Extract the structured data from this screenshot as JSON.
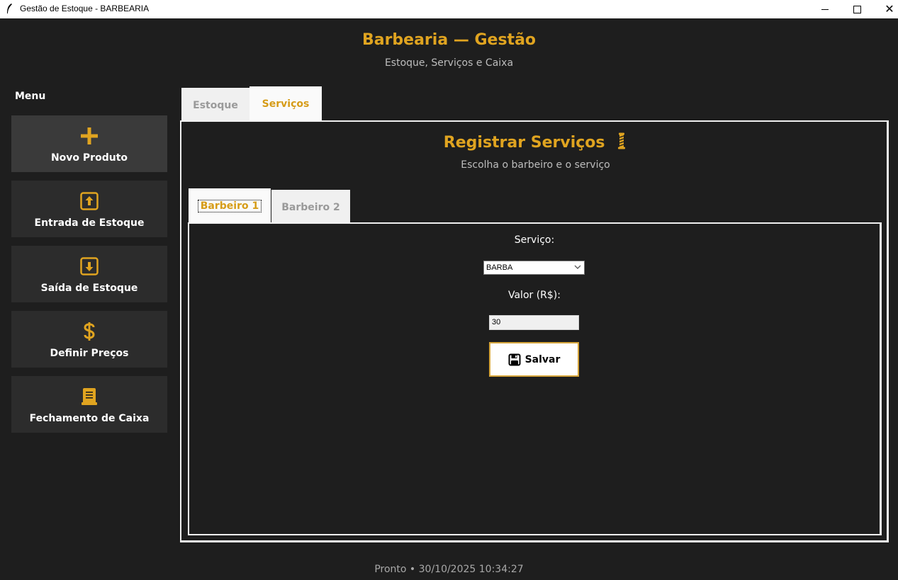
{
  "window": {
    "title": "Gestão de Estoque - BARBEARIA",
    "app_icon": "feather-icon",
    "controls": [
      "minimize-icon",
      "maximize-icon",
      "close-icon"
    ],
    "close_glyph": "✕"
  },
  "header": {
    "title": "Barbearia — Gestão",
    "subtitle": "Estoque, Serviços e Caixa"
  },
  "sidebar": {
    "label": "Menu",
    "items": [
      {
        "label": "Novo Produto",
        "icon": "plus-icon",
        "active": true
      },
      {
        "label": "Entrada de Estoque",
        "icon": "upload-arrow-icon",
        "active": false
      },
      {
        "label": "Saída de Estoque",
        "icon": "download-arrow-icon",
        "active": false
      },
      {
        "label": "Definir Preços",
        "icon": "dollar-icon",
        "active": false
      },
      {
        "label": "Fechamento de Caixa",
        "icon": "receipt-icon",
        "active": false
      }
    ]
  },
  "tabs": [
    {
      "label": "Estoque",
      "selected": false
    },
    {
      "label": "Serviços",
      "selected": true
    }
  ],
  "services": {
    "title": "Registrar Serviços",
    "title_icon": "barber-pole-icon",
    "subtitle": "Escolha o barbeiro e o serviço",
    "barber_tabs": [
      {
        "label": "Barbeiro 1",
        "selected": true
      },
      {
        "label": "Barbeiro 2",
        "selected": false
      }
    ],
    "service_label": "Serviço:",
    "service_value": "BARBA",
    "price_label": "Valor (R$):",
    "price_value": "30",
    "save_label": "Salvar",
    "save_icon": "floppy-disk-icon"
  },
  "status": "Pronto • 30/10/2025 10:34:27",
  "colors": {
    "accent": "#e0a420",
    "background": "#1e1e1e",
    "menu_button": "#2c2c2c",
    "menu_button_active": "#3a3a3a",
    "tab_inactive_text": "#9a9a9a"
  }
}
